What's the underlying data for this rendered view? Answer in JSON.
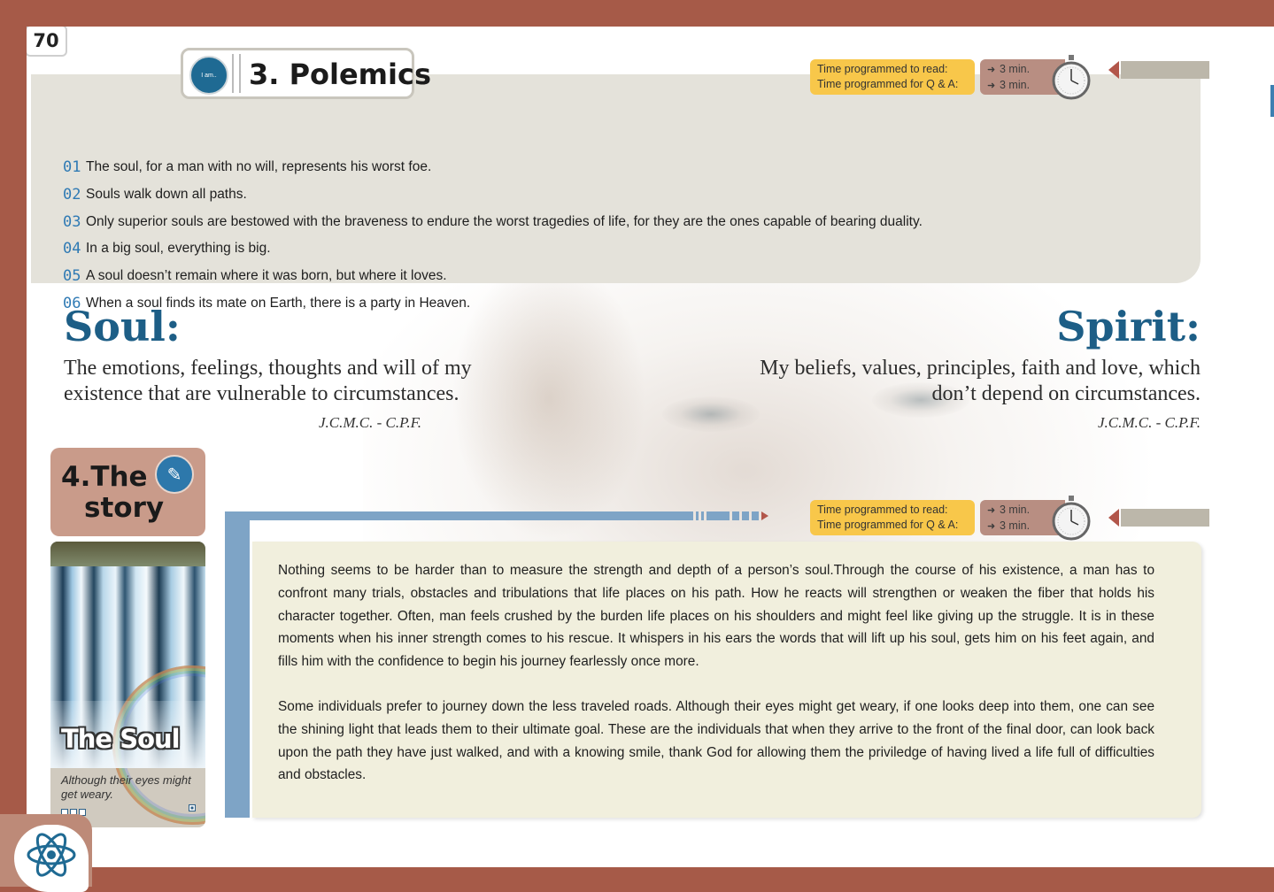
{
  "page_number": "70",
  "polemics": {
    "title": "3. Polemics",
    "icon_label": "I am..",
    "items": [
      {
        "num": "01",
        "text": "The soul, for a man with no will, represents his worst foe."
      },
      {
        "num": "02",
        "text": "Souls walk down all paths."
      },
      {
        "num": "03",
        "text": "Only superior souls are bestowed with the braveness to endure the worst tragedies of life, for they are the ones capable of bearing duality."
      },
      {
        "num": "04",
        "text": "In a big soul, everything is big."
      },
      {
        "num": "05",
        "text": "A soul doesn’t remain where it was born, but where it loves."
      },
      {
        "num": "06",
        "text": "When a soul finds its mate on Earth, there is a party in Heaven."
      }
    ]
  },
  "timer": {
    "read_label": "Time programmed to read:",
    "qa_label": "Time programmed for Q & A:",
    "read_value": "3 min.",
    "qa_value": "3 min."
  },
  "soul": {
    "heading": "Soul:",
    "text_line1": "The emotions, feelings, thoughts and will of my",
    "text_line2": "existence that are vulnerable to circumstances.",
    "author": "J.C.M.C. - C.P.F."
  },
  "spirit": {
    "heading": "Spirit:",
    "text_line1": "My beliefs, values, principles, faith and love, which",
    "text_line2": "don’t depend on circumstances.",
    "author": "J.C.M.C. - C.P.F."
  },
  "story": {
    "label_line1": "4.The",
    "label_line2": "story",
    "image_title": "The Soul",
    "image_caption": "Although their eyes might get weary.",
    "paragraphs": [
      "Nothing seems to be harder than to measure the strength and depth of a person’s soul.Through the course of his existence, a man has to confront many trials, obstacles and tribulations that life places on his path. How he reacts will strengthen or weaken the fiber that holds his character together. Often, man feels crushed by the burden life places on his shoulders and might feel like giving up the struggle. It is in these moments when his inner strength comes to his rescue. It whispers in his ears the words that will lift up his soul, gets him on his feet again, and fills him with the confidence to begin his journey fearlessly once more.",
      "Some individuals prefer to journey down the less traveled roads. Although their eyes might get weary, if one looks deep into them, one can see the shining light that leads them to their ultimate goal. These are the individuals that when they arrive to the front of the final door, can look back upon the path they have just walked, and with a knowing smile, thank God for allowing them the priviledge of having lived a life full of difficulties and obstacles."
    ]
  },
  "colors": {
    "frame": "#a65a48",
    "accent_blue": "#1d5e86",
    "timer_yellow": "#f8c74a",
    "timer_brown": "#b88e82",
    "story_panel": "#f1efdd"
  }
}
